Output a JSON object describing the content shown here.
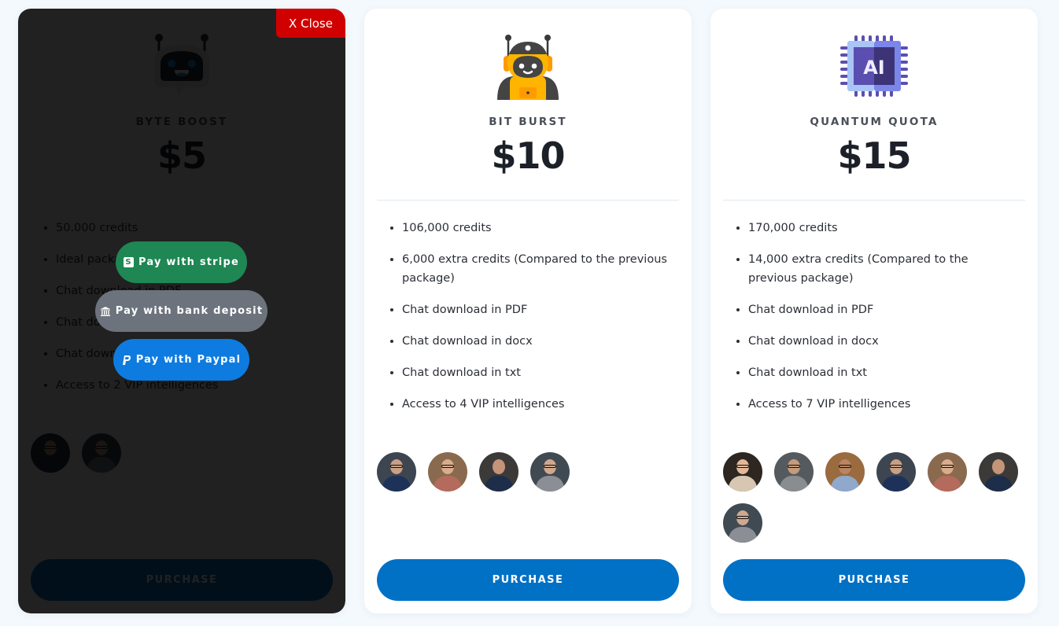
{
  "plans": [
    {
      "name": "BYTE BOOST",
      "price": "$5",
      "icon": "chat-robot-icon",
      "features": [
        "50.000 credits",
        "Ideal package for beginners",
        "Chat download in PDF",
        "Chat download in docx",
        "Chat download in txt",
        "Access to 2 VIP intelligences"
      ],
      "avatar_count": 2,
      "purchase_label": "PURCHASE",
      "payment_overlay": {
        "close_label": "X Close",
        "options": [
          {
            "label": "Pay with stripe",
            "icon": "stripe-icon",
            "color": "#1e8754"
          },
          {
            "label": "Pay with bank deposit",
            "icon": "bank-icon",
            "color": "#6c737d"
          },
          {
            "label": "Pay with Paypal",
            "icon": "paypal-icon",
            "color": "#0e7be0"
          }
        ]
      }
    },
    {
      "name": "BIT BURST",
      "price": "$10",
      "icon": "yellow-robot-icon",
      "features": [
        "106,000 credits",
        "6,000 extra credits (Compared to the previous package)",
        "Chat download in PDF",
        "Chat download in docx",
        "Chat download in txt",
        "Access to 4 VIP intelligences"
      ],
      "avatar_count": 4,
      "purchase_label": "PURCHASE"
    },
    {
      "name": "QUANTUM QUOTA",
      "price": "$15",
      "icon": "ai-chip-icon",
      "features": [
        "170,000 credits",
        "14,000 extra credits (Compared to the previous package)",
        "Chat download in PDF",
        "Chat download in docx",
        "Chat download in txt",
        "Access to 7 VIP intelligences"
      ],
      "avatar_count": 7,
      "purchase_label": "PURCHASE"
    }
  ],
  "colors": {
    "primary": "#0171c6",
    "close": "#d10000",
    "stripe": "#1e8754",
    "bank": "#6c737d",
    "paypal": "#0e7be0"
  }
}
